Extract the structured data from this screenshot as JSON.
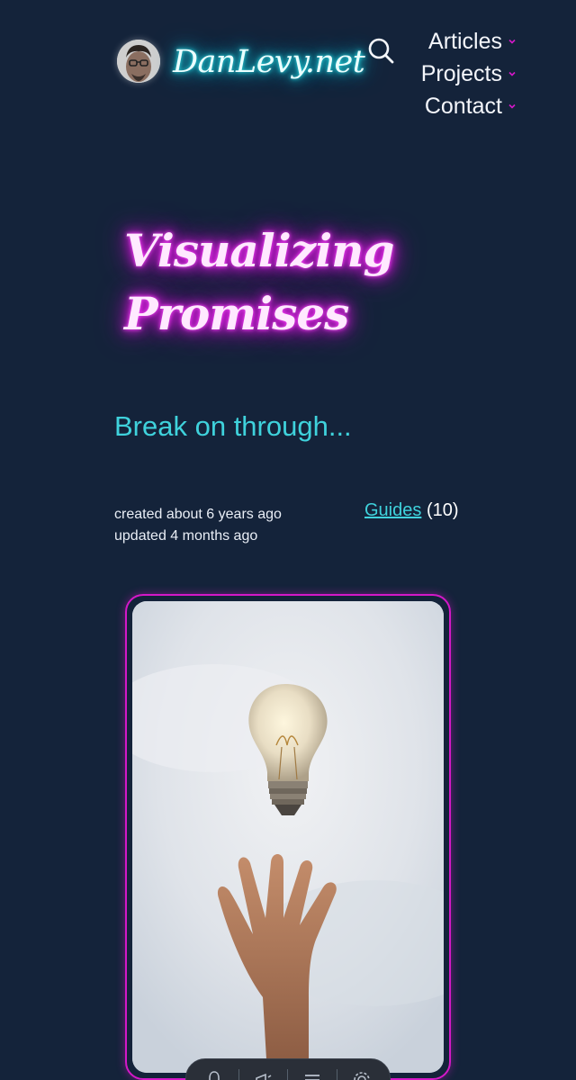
{
  "header": {
    "site_name": "DanLevy.net",
    "nav": [
      {
        "label": "Articles"
      },
      {
        "label": "Projects"
      },
      {
        "label": "Contact"
      }
    ],
    "icons": {
      "search": "search-icon",
      "caret": "chevron-down-icon"
    }
  },
  "article": {
    "title_line1": "Visualizing",
    "title_line2": "Promises",
    "subtitle": "Break on through...",
    "created": "created about 6 years ago",
    "updated": "updated 4 months ago",
    "category": "Guides",
    "category_count": "(10)"
  },
  "colors": {
    "background": "#14233a",
    "cyan_accent": "#3fd2dc",
    "magenta_accent": "#d418c8"
  },
  "toolbar": {
    "icons": [
      "alert-icon",
      "announce-icon",
      "menu-icon",
      "gear-icon"
    ]
  }
}
